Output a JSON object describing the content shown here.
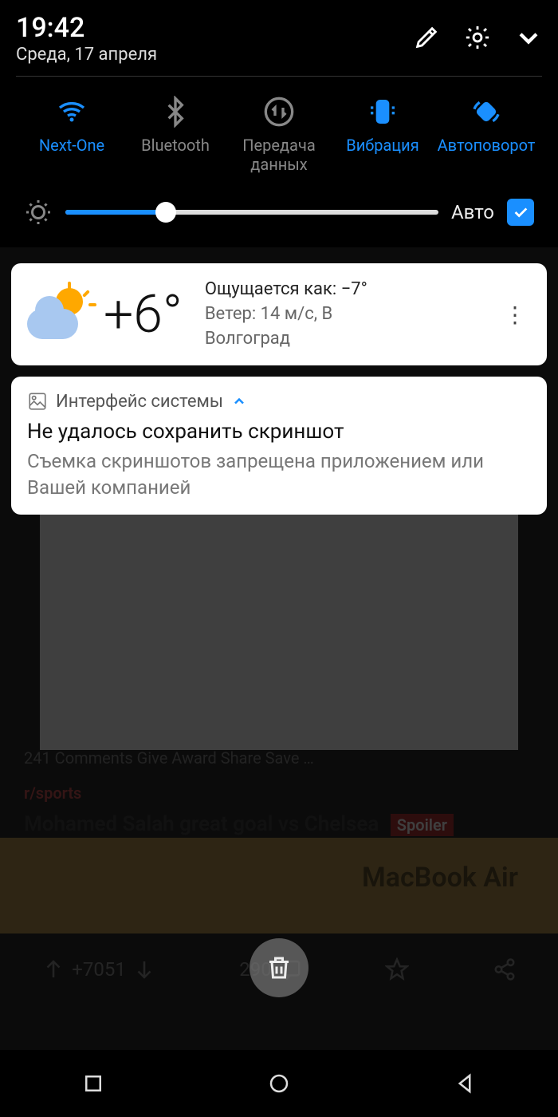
{
  "status": {
    "time": "19:42",
    "date": "Среда, 17 апреля"
  },
  "qs": {
    "tiles": [
      {
        "label": "Next-One"
      },
      {
        "label": "Bluetooth"
      },
      {
        "label": "Передача данных"
      },
      {
        "label": "Вибрация"
      },
      {
        "label": "Автоповорот"
      }
    ],
    "auto_label": "Авто"
  },
  "weather": {
    "temp": "+6°",
    "feels_label": "Ощущается как: −7°",
    "wind_label": "Ветер: 14 м/с, В",
    "city": "Волгоград"
  },
  "notification": {
    "app": "Интерфейс системы",
    "title": "Не удалось сохранить скриншот",
    "body": "Съемка скриншотов запрещена приложением или Вашей компанией"
  },
  "background": {
    "comments_row": "241 Comments    Give Award    Share    Save    …",
    "subreddit_row": "r/sports",
    "headline": "Mohamed Salah great goal vs Chelsea",
    "spoiler_tag": "Spoiler",
    "device_label": "MacBook Air",
    "upvotes": "+7051",
    "comment_count": "290"
  }
}
